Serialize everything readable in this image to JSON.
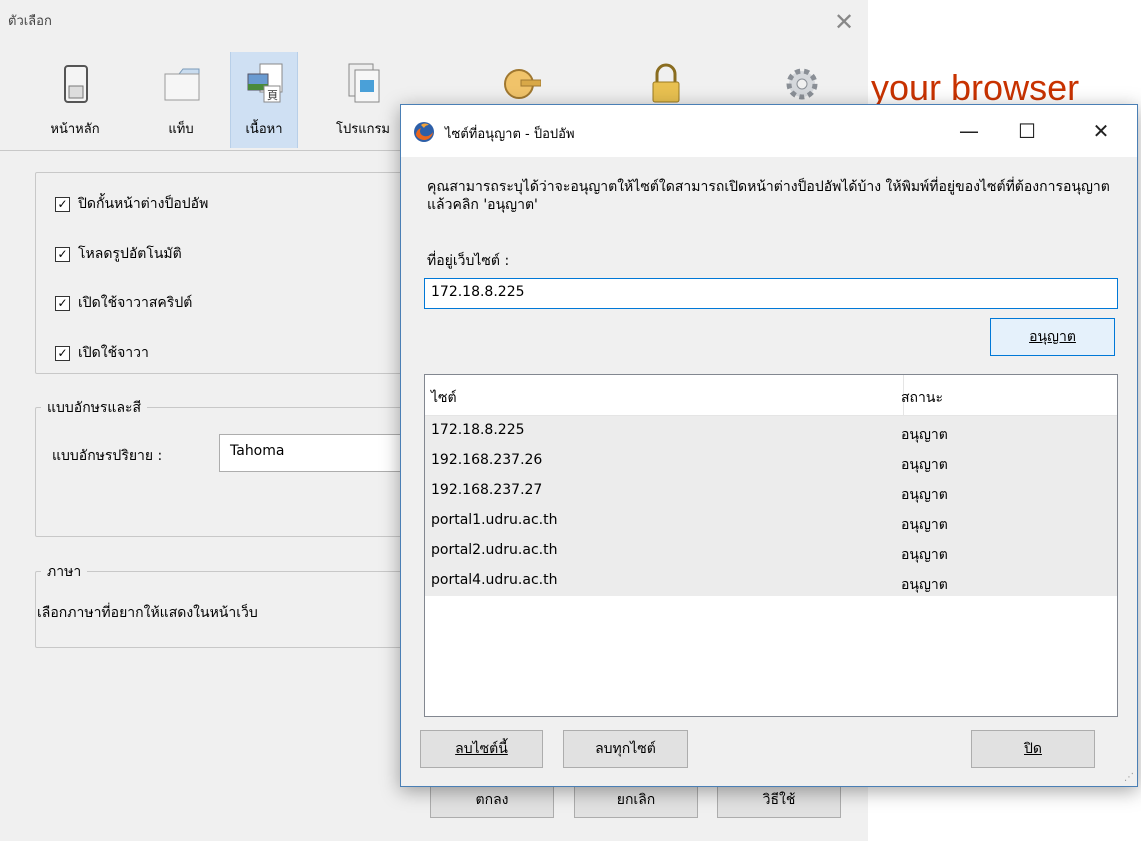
{
  "options_window": {
    "title": "ตัวเลือก",
    "toolbar": [
      {
        "label": "หน้าหลัก",
        "icon": "general-icon"
      },
      {
        "label": "แท็บ",
        "icon": "tabs-icon"
      },
      {
        "label": "เนื้อหา",
        "icon": "content-icon",
        "active": true
      },
      {
        "label": "โปรแกรม",
        "icon": "applications-icon"
      },
      {
        "label": "",
        "icon": "privacy-icon"
      },
      {
        "label": "",
        "icon": "security-icon"
      },
      {
        "label": "",
        "icon": "advanced-icon"
      }
    ],
    "checkboxes": [
      {
        "label": "ปิดกั้นหน้าต่างป็อปอัพ",
        "checked": true
      },
      {
        "label": "โหลดรูปอัตโนมัติ",
        "checked": true
      },
      {
        "label": "เปิดใช้จาวาสคริปต์",
        "checked": true
      },
      {
        "label": "เปิดใช้จาวา",
        "checked": true
      }
    ],
    "fonts_group": {
      "legend": "แบบอักษรและสี",
      "default_font_label": "แบบอักษรปริยาย :",
      "default_font_value": "Tahoma"
    },
    "language_group": {
      "legend": "ภาษา",
      "description": "เลือกภาษาที่อยากให้แสดงในหน้าเว็บ"
    },
    "buttons": {
      "ok": "ตกลง",
      "cancel": "ยกเลิก",
      "help": "วิธีใช้"
    }
  },
  "web_content": {
    "brand_text": "your browser"
  },
  "dialog": {
    "title": "ไซต์ที่อนุญาต - ป็อปอัพ",
    "controls": {
      "minimize": "—",
      "maximize": "☐",
      "close": "✕"
    },
    "description": "คุณสามารถระบุได้ว่าจะอนุญาตให้ไซต์ใดสามารถเปิดหน้าต่างป็อปอัพได้บ้าง ให้พิมพ์ที่อยู่ของไซต์ที่ต้องการอนุญาตแล้วคลิก 'อนุญาต'",
    "address_label": "ที่อยู่เว็บไซต์ :",
    "address_value": "172.18.8.225",
    "allow_button": "อนุญาต",
    "columns": {
      "site": "ไซต์",
      "status": "สถานะ"
    },
    "rows": [
      {
        "site": "172.18.8.225",
        "status": "อนุญาต"
      },
      {
        "site": "192.168.237.26",
        "status": "อนุญาต"
      },
      {
        "site": "192.168.237.27",
        "status": "อนุญาต"
      },
      {
        "site": "portal1.udru.ac.th",
        "status": "อนุญาต"
      },
      {
        "site": "portal2.udru.ac.th",
        "status": "อนุญาต"
      },
      {
        "site": "portal4.udru.ac.th",
        "status": "อนุญาต"
      }
    ],
    "remove_site_button": "ลบไซต์นี้",
    "remove_all_button": "ลบทุกไซต์",
    "close_button": "ปิด",
    "accent_color": "#0078d7"
  }
}
